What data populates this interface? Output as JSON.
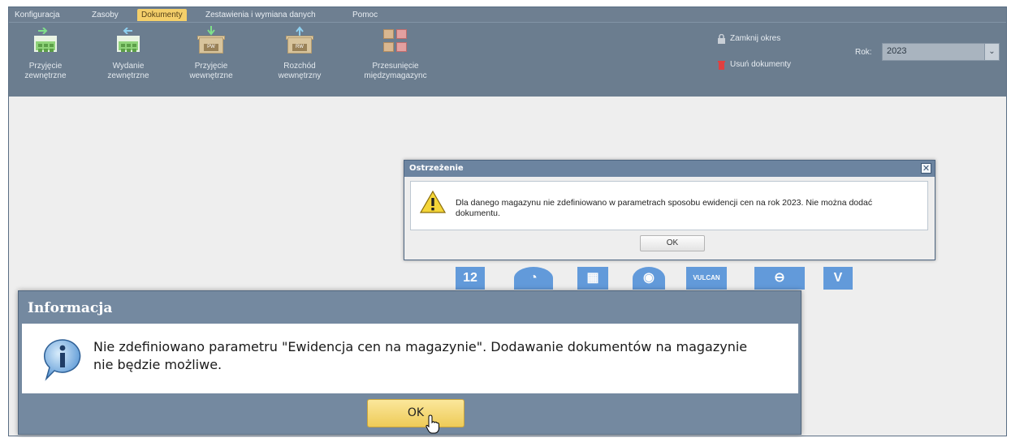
{
  "menu": {
    "items": [
      {
        "label": "Konfiguracja"
      },
      {
        "label": "Zasoby"
      },
      {
        "label": "Dokumenty"
      },
      {
        "label": "Zestawienia i wymiana danych"
      },
      {
        "label": "Pomoc"
      }
    ],
    "active": "Dokumenty"
  },
  "ribbon": {
    "buttons": [
      {
        "line1": "Przyjęcie",
        "line2": "zewnętrzne",
        "icon": "calendar-grid-in-icon"
      },
      {
        "line1": "Wydanie",
        "line2": "zewnętrzne",
        "icon": "calendar-grid-out-icon"
      },
      {
        "line1": "Przyjęcie",
        "line2": "wewnętrzne",
        "icon": "box-pw-icon",
        "tag": "PW"
      },
      {
        "line1": "Rozchód",
        "line2": "wewnętrzny",
        "icon": "box-rw-icon",
        "tag": "RW"
      },
      {
        "line1": "Przesunięcie",
        "line2": "międzymagazync",
        "icon": "transfer-boxes-icon"
      }
    ],
    "close_period": "Zamknij okres",
    "delete_documents": "Usuń dokumenty",
    "year_label": "Rok:",
    "year_value": "2023",
    "year_arrow": "⌄"
  },
  "background_icons": [
    {
      "name": "calendar-12-icon",
      "text": "12"
    },
    {
      "name": "pie-chart-icon",
      "text": "◔"
    },
    {
      "name": "checklist-icon",
      "text": "▦"
    },
    {
      "name": "lightbulb-icon",
      "text": "◉"
    },
    {
      "name": "vulcan-logo-icon",
      "text": "VULCAN"
    },
    {
      "name": "switch-icon",
      "text": "⊖"
    },
    {
      "name": "v-logo-icon",
      "text": "V"
    }
  ],
  "warning_dialog": {
    "title": "Ostrzeżenie",
    "close_symbol": "✕",
    "message": "Dla danego magazynu nie zdefiniowano w parametrach sposobu ewidencji cen na rok 2023. Nie można dodać dokumentu.",
    "ok": "OK"
  },
  "info_dialog": {
    "title": "Informacja",
    "message": "Nie zdefiniowano parametru \"Ewidencja cen na magazynie\". Dodawanie dokumentów na magazynie nie będzie możliwe.",
    "ok": "OK"
  },
  "colors": {
    "ribbon": "#6b7d8f",
    "menubar": "#6e7f91",
    "active_tab": "#f4cf6a",
    "dialog_header": "#6c84a0",
    "info_header": "#7489a0",
    "ok_highlight": "#eecb58"
  }
}
